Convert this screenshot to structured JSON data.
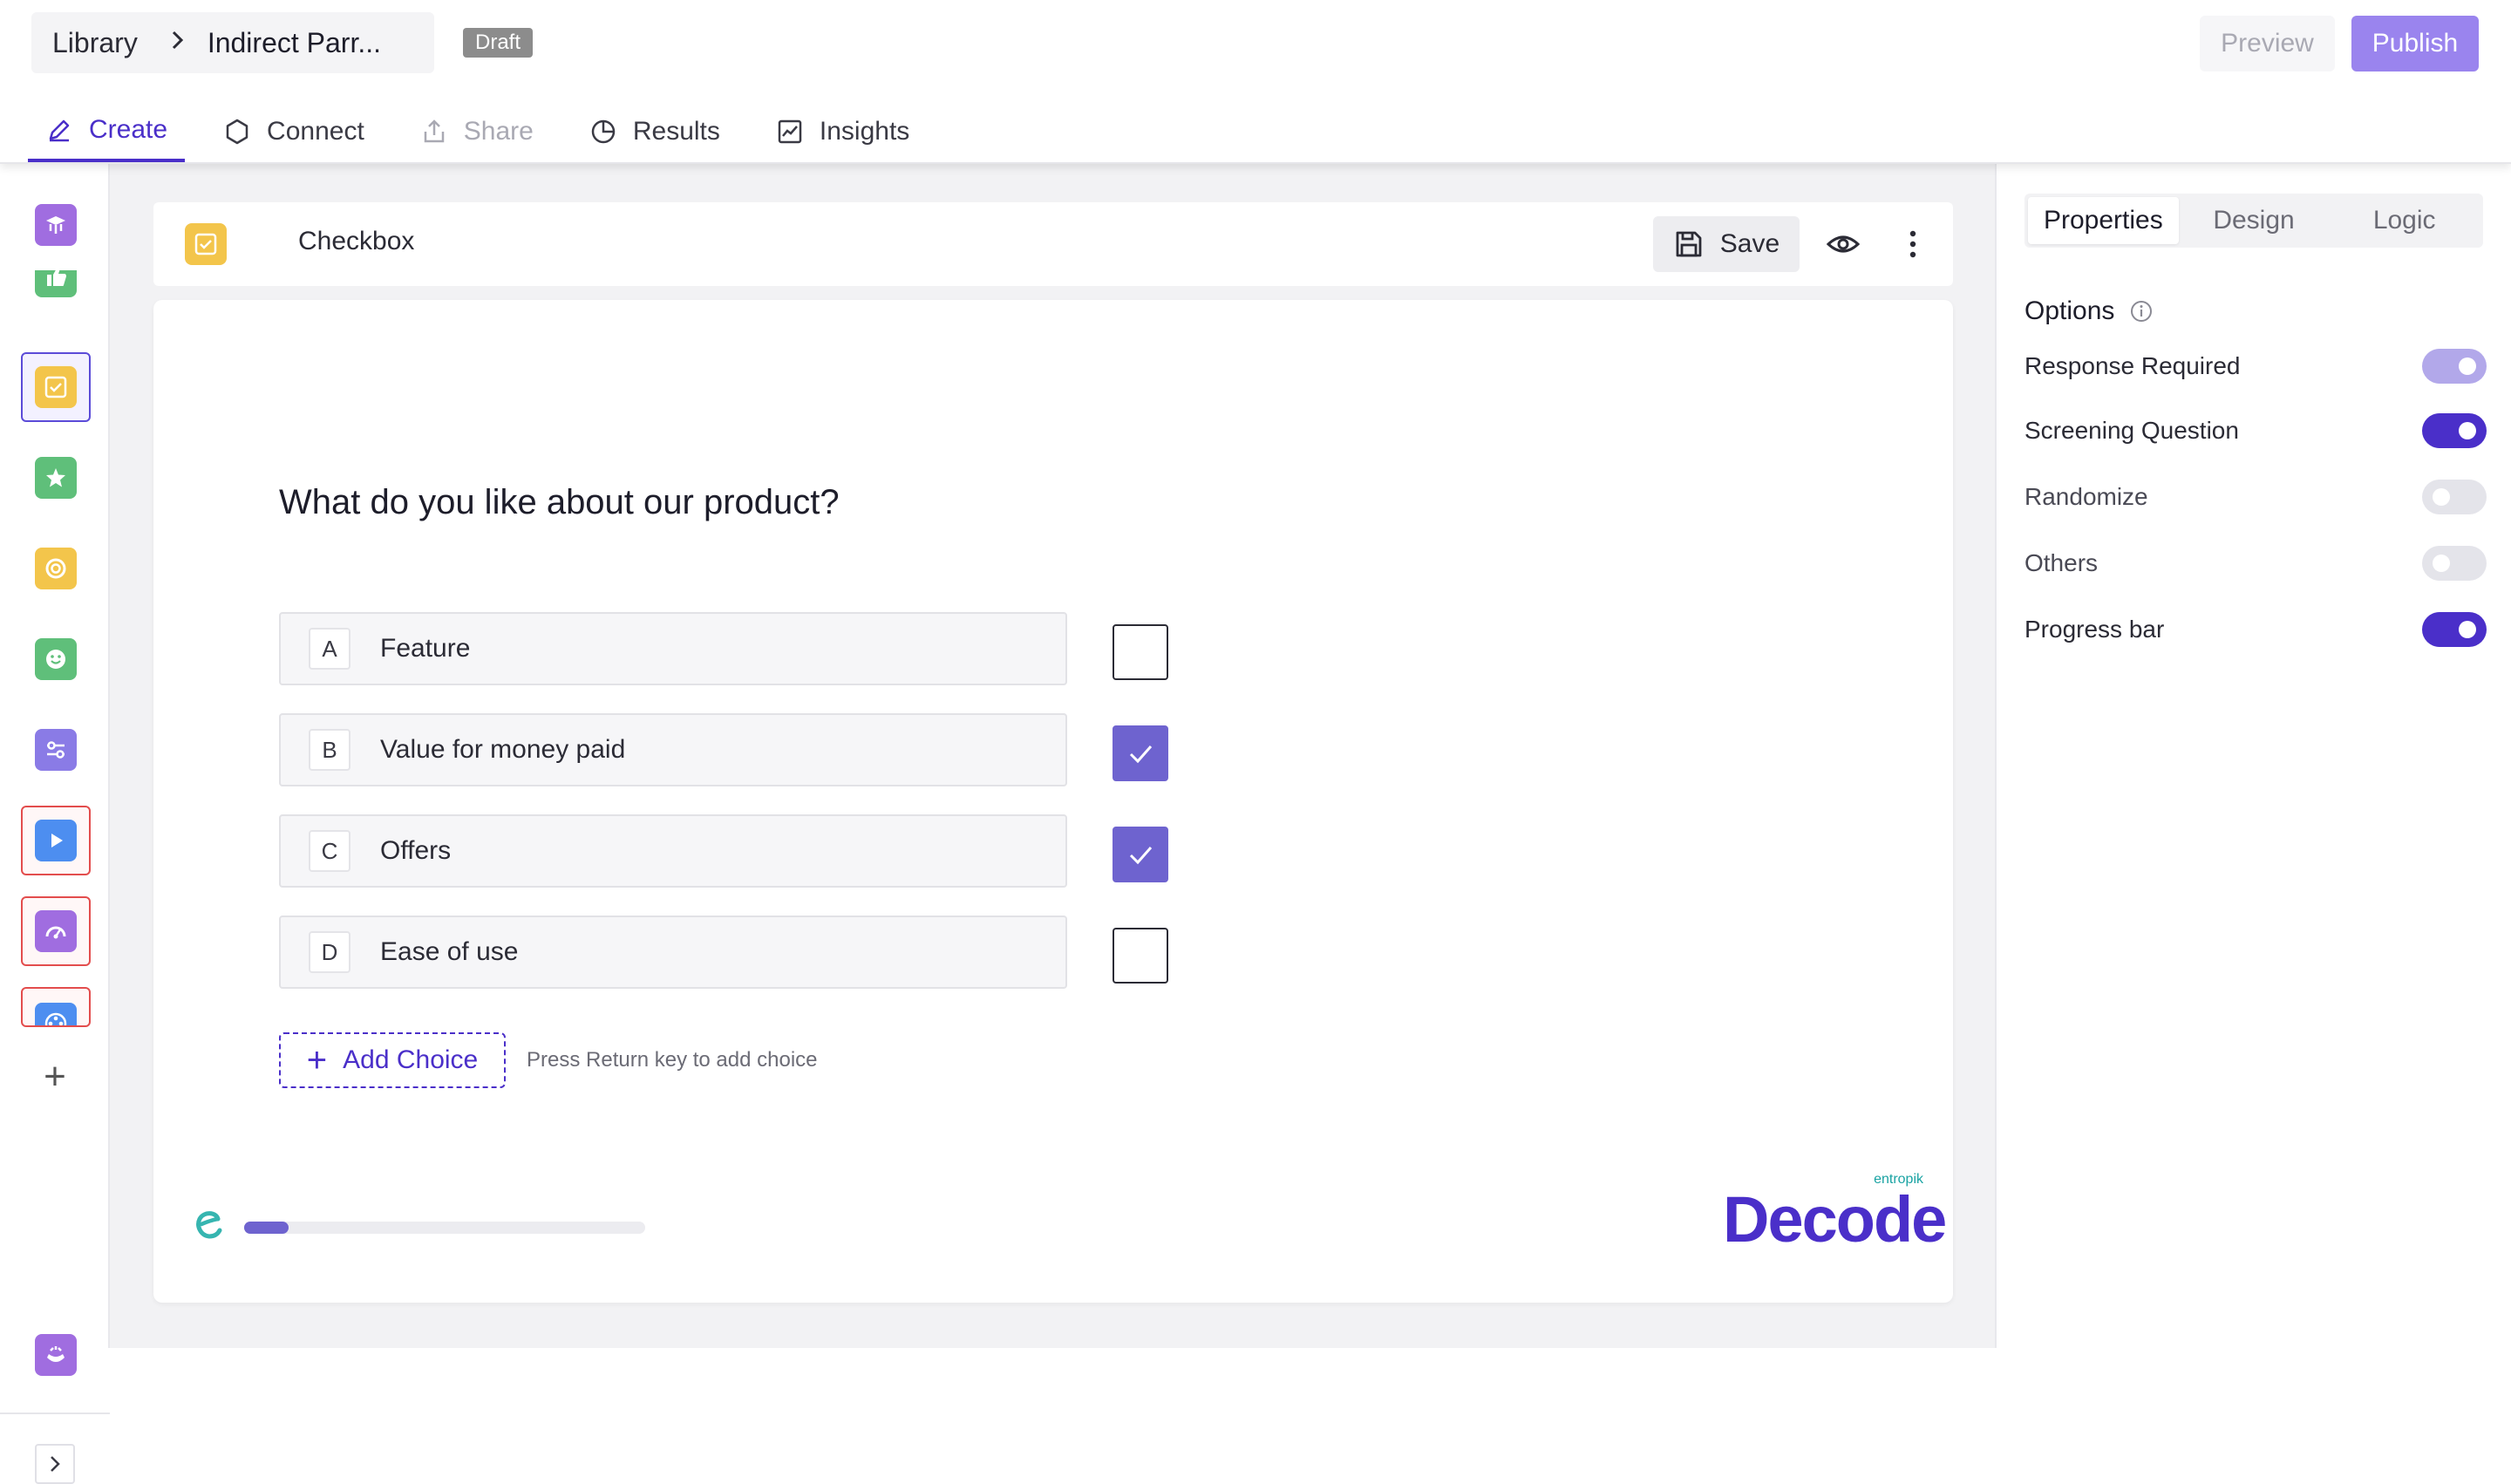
{
  "header": {
    "breadcrumb_root": "Library",
    "breadcrumb_current": "Indirect Parr...",
    "status_badge": "Draft",
    "preview_label": "Preview",
    "publish_label": "Publish"
  },
  "tabs": [
    {
      "label": "Create",
      "icon": "pencil-icon",
      "state": "active"
    },
    {
      "label": "Connect",
      "icon": "hexagon-icon",
      "state": "normal"
    },
    {
      "label": "Share",
      "icon": "share-icon",
      "state": "disabled"
    },
    {
      "label": "Results",
      "icon": "pie-chart-icon",
      "state": "normal"
    },
    {
      "label": "Insights",
      "icon": "trend-chart-icon",
      "state": "normal"
    }
  ],
  "left_rail": {
    "items": [
      {
        "icon": "intro-icon",
        "color": "#a06de0"
      },
      {
        "icon": "thumbs-up-icon",
        "color": "#5fbf7a"
      },
      {
        "icon": "checkbox-icon",
        "color": "#f3c54b",
        "selected": true
      },
      {
        "icon": "star-icon",
        "color": "#5fbf7a"
      },
      {
        "icon": "target-icon",
        "color": "#f3c54b"
      },
      {
        "icon": "smiley-icon",
        "color": "#5fbf7a"
      },
      {
        "icon": "slider-icon",
        "color": "#8a7be6"
      },
      {
        "icon": "video-play-icon",
        "color": "#4d8ef0",
        "error": true
      },
      {
        "icon": "gauge-icon",
        "color": "#a06de0",
        "error": true
      },
      {
        "icon": "film-reel-icon",
        "color": "#4d8ef0",
        "error": true
      },
      {
        "icon": "end-screen-icon",
        "color": "#a06de0"
      }
    ]
  },
  "question": {
    "type_label": "Checkbox",
    "save_label": "Save",
    "title": "What do you like about our product?",
    "choices": [
      {
        "letter": "A",
        "text": "Feature",
        "checked": false
      },
      {
        "letter": "B",
        "text": "Value for money paid",
        "checked": true
      },
      {
        "letter": "C",
        "text": "Offers",
        "checked": true
      },
      {
        "letter": "D",
        "text": "Ease of use",
        "checked": false
      }
    ],
    "add_choice_label": "Add Choice",
    "add_choice_hint": "Press Return key to add choice",
    "progress_fraction": 0.11,
    "brand_small": "entropik",
    "brand_word": "Decode"
  },
  "right_panel": {
    "tabs": [
      "Properties",
      "Design",
      "Logic"
    ],
    "active_tab": "Properties",
    "options_heading": "Options",
    "options": [
      {
        "label": "Response Required",
        "on": true,
        "faded": true
      },
      {
        "label": "Screening Question",
        "on": true,
        "faded": false
      },
      {
        "label": "Randomize",
        "on": false,
        "faded": false
      },
      {
        "label": "Others",
        "on": false,
        "faded": false
      },
      {
        "label": "Progress bar",
        "on": true,
        "faded": false
      }
    ]
  },
  "colors": {
    "accent": "#4a2fc9",
    "check_fill": "#6e63cf",
    "publish": "#9a84ee",
    "draft": "#8c8c8c"
  }
}
